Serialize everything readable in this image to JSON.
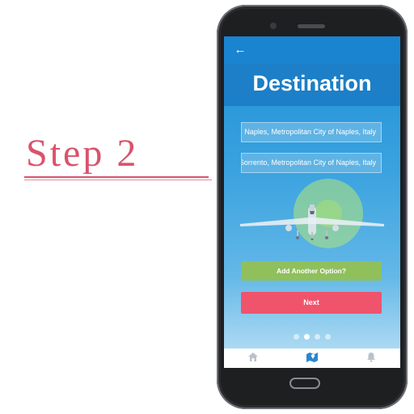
{
  "caption": {
    "text": "Step 2"
  },
  "screen": {
    "title": "Destination",
    "fields": [
      {
        "value": "Naples, Metropolitan City of Naples, Italy"
      },
      {
        "value": "Sorrento, Metropolitan City of Naples, Italy"
      }
    ],
    "add_option_label": "Add Another Option?",
    "next_label": "Next",
    "pager": {
      "total": 4,
      "active_index": 1
    },
    "bottom_nav": [
      {
        "icon": "home-icon"
      },
      {
        "icon": "map-icon",
        "active": true
      },
      {
        "icon": "bell-icon"
      }
    ]
  },
  "colors": {
    "accent_pink": "#d9536c",
    "app_blue": "#1a84d0",
    "add_button_green": "#8fc05c",
    "next_button_red": "#f0546d"
  }
}
